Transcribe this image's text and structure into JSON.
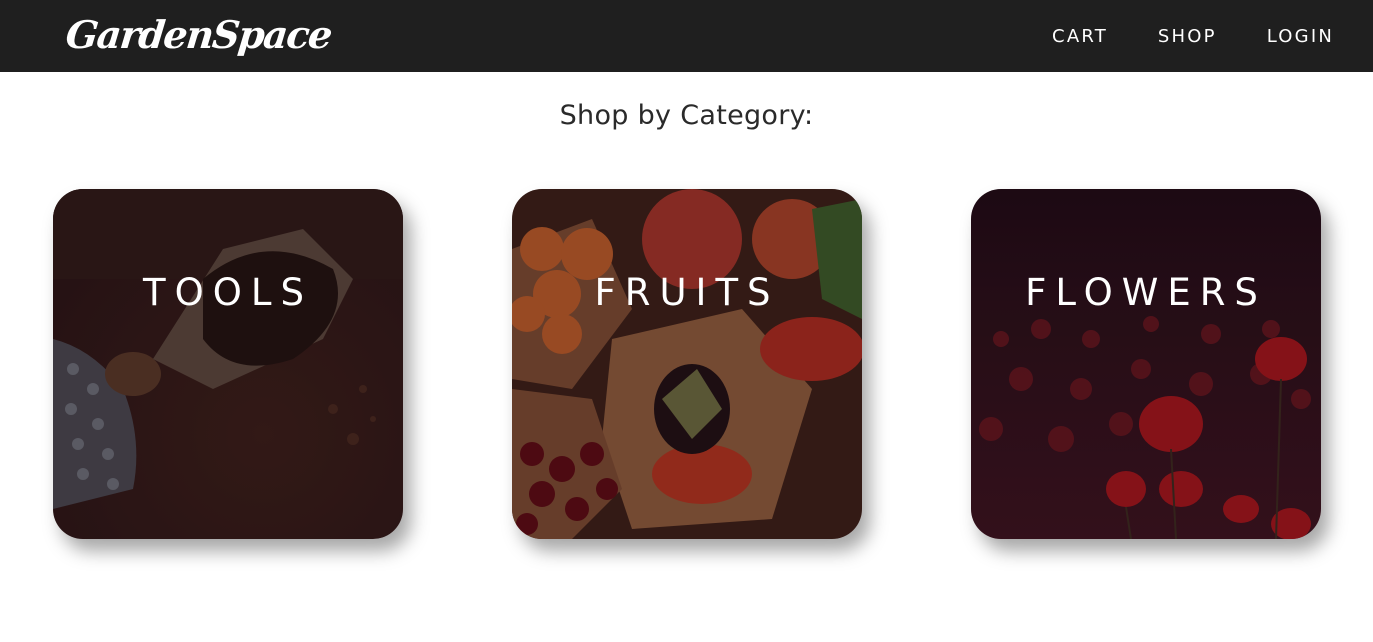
{
  "header": {
    "logo_text": "GardenSpace",
    "nav": [
      {
        "label": "CART"
      },
      {
        "label": "SHOP"
      },
      {
        "label": "LOGIN"
      }
    ]
  },
  "main": {
    "heading": "Shop by Category:",
    "categories": [
      {
        "label": "TOOLS"
      },
      {
        "label": "FRUITS"
      },
      {
        "label": "FLOWERS"
      }
    ]
  }
}
